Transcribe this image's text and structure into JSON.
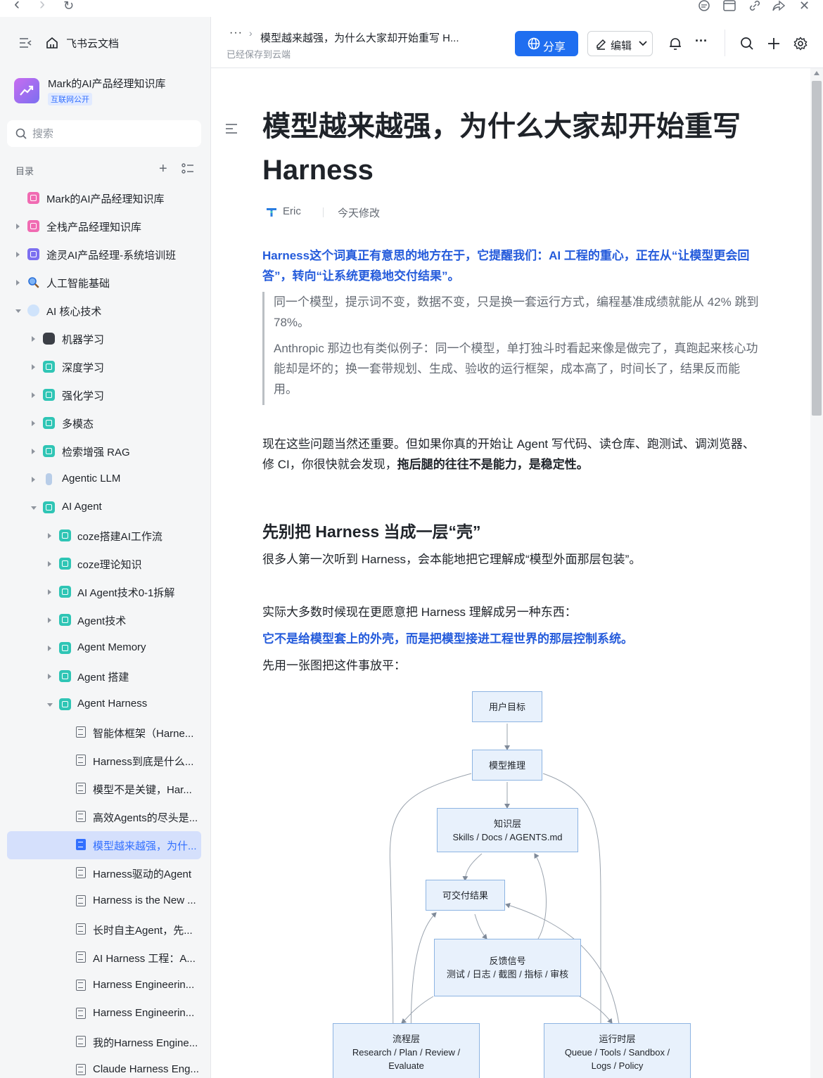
{
  "window": {
    "back": "‹",
    "forward": "›",
    "refresh": "↻",
    "close": "✕"
  },
  "sidebar": {
    "brand": "飞书云文档",
    "knowledge_base": {
      "name": "Mark的AI产品经理知识库",
      "tag": "互联网公开"
    },
    "search_placeholder": "搜索",
    "toc_label": "目录",
    "add": "+",
    "items": [
      {
        "label": "Mark的AI产品经理知识库"
      },
      {
        "label": "全栈产品经理知识库"
      },
      {
        "label": "途灵AI产品经理-系统培训班"
      },
      {
        "label": "人工智能基础"
      },
      {
        "label": "AI 核心技术"
      },
      {
        "label": "机器学习"
      },
      {
        "label": "深度学习"
      },
      {
        "label": "强化学习"
      },
      {
        "label": "多模态"
      },
      {
        "label": "检索增强 RAG"
      },
      {
        "label": "Agentic LLM"
      },
      {
        "label": "AI Agent"
      },
      {
        "label": "coze搭建AI工作流"
      },
      {
        "label": "coze理论知识"
      },
      {
        "label": "AI Agent技术0-1拆解"
      },
      {
        "label": "Agent技术"
      },
      {
        "label": "Agent Memory"
      },
      {
        "label": "Agent 搭建"
      },
      {
        "label": "Agent Harness"
      },
      {
        "label": "智能体框架（Harne..."
      },
      {
        "label": "Harness到底是什么..."
      },
      {
        "label": "模型不是关键，Har..."
      },
      {
        "label": "高效Agents的尽头是..."
      },
      {
        "label": "模型越来越强，为什..."
      },
      {
        "label": "Harness驱动的Agent"
      },
      {
        "label": "Harness is the New ..."
      },
      {
        "label": "长时自主Agent，先..."
      },
      {
        "label": "AI Harness 工程：A..."
      },
      {
        "label": "Harness Engineerin..."
      },
      {
        "label": "Harness Engineerin..."
      },
      {
        "label": "我的Harness Engine..."
      },
      {
        "label": "Claude Harness Eng..."
      }
    ]
  },
  "header": {
    "dots": "···",
    "sep": "›",
    "breadcrumb": "模型越来越强，为什么大家却开始重写 H...",
    "saved": "已经保存到云端",
    "share": "分享",
    "edit": "编辑",
    "more": "···"
  },
  "doc": {
    "title": "模型越来越强，为什么大家却开始重写 Harness",
    "author": "Eric",
    "modified": "今天修改",
    "lead": "Harness这个词真正有意思的地方在于，它提醒我们：AI 工程的重心，正在从“让模型更会回答”，转向“让系统更稳地交付结果”。",
    "quote1": "同一个模型，提示词不变，数据不变，只是换一套运行方式，编程基准成绩就能从 42% 跳到 78%。",
    "quote2": "Anthropic 那边也有类似例子：同一个模型，单打独斗时看起来像是做完了，真跑起来核心功能却是坏的；换一套带规划、生成、验收的运行框架，成本高了，时间长了，结果反而能用。",
    "p1_normal": "现在这些问题当然还重要。但如果你真的开始让 Agent 写代码、读仓库、跑测试、调浏览器、修 CI，你很快就会发现，",
    "p1_bold": "拖后腿的往往不是能力，是稳定性。",
    "h2": "先别把 Harness 当成一层“壳”",
    "p2": "很多人第一次听到 Harness，会本能地把它理解成“模型外面那层包装”。",
    "p3": "实际大多数时候现在更愿意把 Harness 理解成另一种东西：",
    "p4": "它不是给模型套上的外壳，而是把模型接进工程世界的那层控制系统。",
    "p5": "先用一张图把这件事放平："
  },
  "diagram": {
    "user_goal": "用户目标",
    "model_reasoning": "模型推理",
    "knowledge_title": "知识层",
    "knowledge_sub": "Skills / Docs / AGENTS.md",
    "deliverable": "可交付结果",
    "feedback_title": "反馈信号",
    "feedback_sub": "测试 / 日志 / 截图 / 指标 / 审核",
    "process_title": "流程层",
    "process_sub": "Research / Plan / Review / Evaluate",
    "runtime_title": "运行时层",
    "runtime_sub": "Queue / Tools / Sandbox / Logs / Policy"
  }
}
